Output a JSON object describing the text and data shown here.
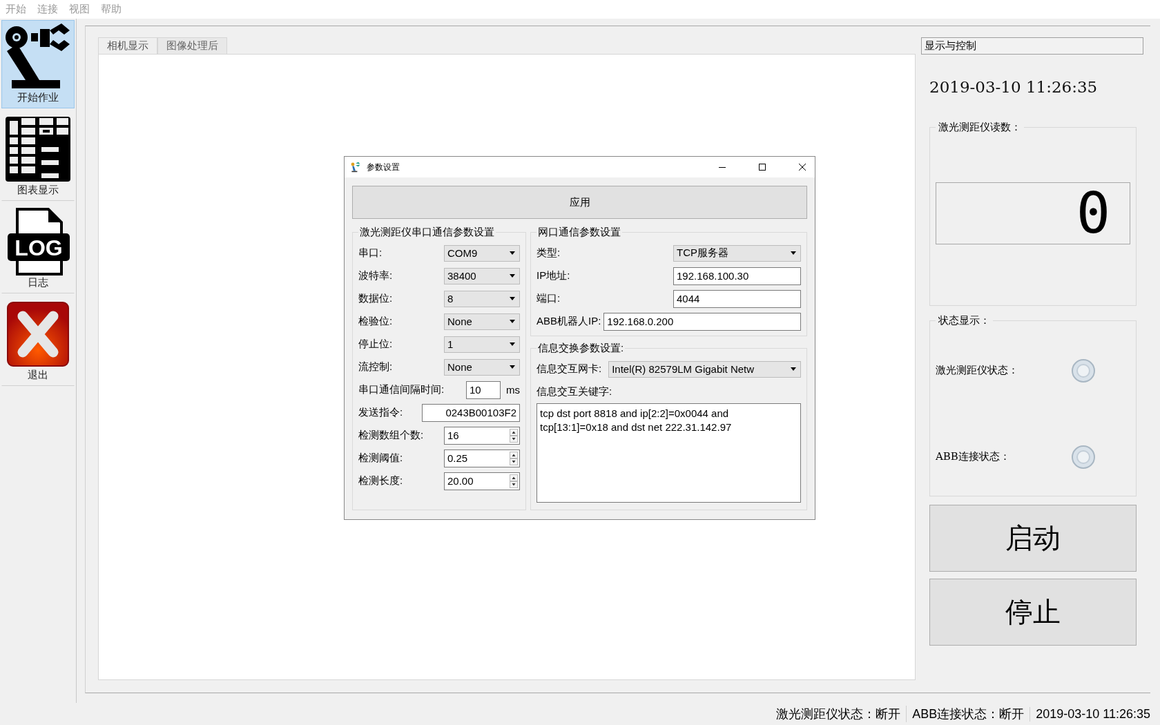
{
  "menu": [
    "开始",
    "连接",
    "视图",
    "帮助"
  ],
  "sidebar": {
    "items": [
      {
        "label": "开始作业",
        "kind": "robot",
        "selected": true
      },
      {
        "label": "图表显示",
        "kind": "table",
        "selected": false
      },
      {
        "label": "日志",
        "kind": "log",
        "icon_text": "LOG",
        "selected": false
      },
      {
        "label": "退出",
        "kind": "exit",
        "selected": false
      }
    ]
  },
  "tabs": [
    {
      "label": "相机显示",
      "selected": true
    },
    {
      "label": "图像处理后",
      "selected": false
    }
  ],
  "dialog": {
    "title": "参数设置",
    "apply_button": "应用",
    "serial_group": {
      "title": "激光测距仪串口通信参数设置",
      "fields": [
        {
          "label": "串口:",
          "kind": "combo",
          "value": "COM9"
        },
        {
          "label": "波特率:",
          "kind": "combo",
          "value": "38400"
        },
        {
          "label": "数据位:",
          "kind": "combo",
          "value": "8"
        },
        {
          "label": "检验位:",
          "kind": "combo",
          "value": "None"
        },
        {
          "label": "停止位:",
          "kind": "combo",
          "value": "1"
        },
        {
          "label": "流控制:",
          "kind": "combo",
          "value": "None"
        },
        {
          "label": "串口通信间隔时间:",
          "kind": "unit",
          "value": "10",
          "unit": "ms"
        },
        {
          "label": "发送指令:",
          "kind": "text",
          "value": "0243B00103F2"
        },
        {
          "label": "检测数组个数:",
          "kind": "spin",
          "value": "16"
        },
        {
          "label": "检测阈值:",
          "kind": "spin",
          "value": "0.25"
        },
        {
          "label": "检测长度:",
          "kind": "spin",
          "value": "20.00"
        }
      ]
    },
    "network_group": {
      "title": "网口通信参数设置",
      "fields": [
        {
          "label": "类型:",
          "kind": "combo",
          "value": "TCP服务器"
        },
        {
          "label": "IP地址:",
          "kind": "input",
          "value": "192.168.100.30"
        },
        {
          "label": "端口:",
          "kind": "input",
          "value": "4044"
        },
        {
          "label": "ABB机器人IP:",
          "kind": "wide",
          "value": "192.168.0.200"
        }
      ]
    },
    "exchange_group": {
      "title": "信息交换参数设置:",
      "card_label": "信息交互网卡:",
      "card_value": "Intel(R) 82579LM Gigabit Netw",
      "keyword_label": "信息交互关键字:",
      "keyword_value": "tcp dst port 8818 and ip[2:2]=0x0044 and\ntcp[13:1]=0x18 and dst net 222.31.142.97"
    }
  },
  "right_panel": {
    "title": "显示与控制",
    "datetime": "2019-03-10  11:26:35",
    "reading_group": {
      "title": "激光测距仪读数：",
      "value": "0"
    },
    "status_group": {
      "title": "状态显示：",
      "indicators": [
        {
          "label": "激光测距仪状态：",
          "on": false
        },
        {
          "label": "ABB连接状态：",
          "on": false
        }
      ]
    },
    "buttons": [
      "启动",
      "停止"
    ]
  },
  "status_bar": [
    "激光测距仪状态：断开",
    "ABB连接状态：断开",
    "2019-03-10 11:26:35"
  ]
}
